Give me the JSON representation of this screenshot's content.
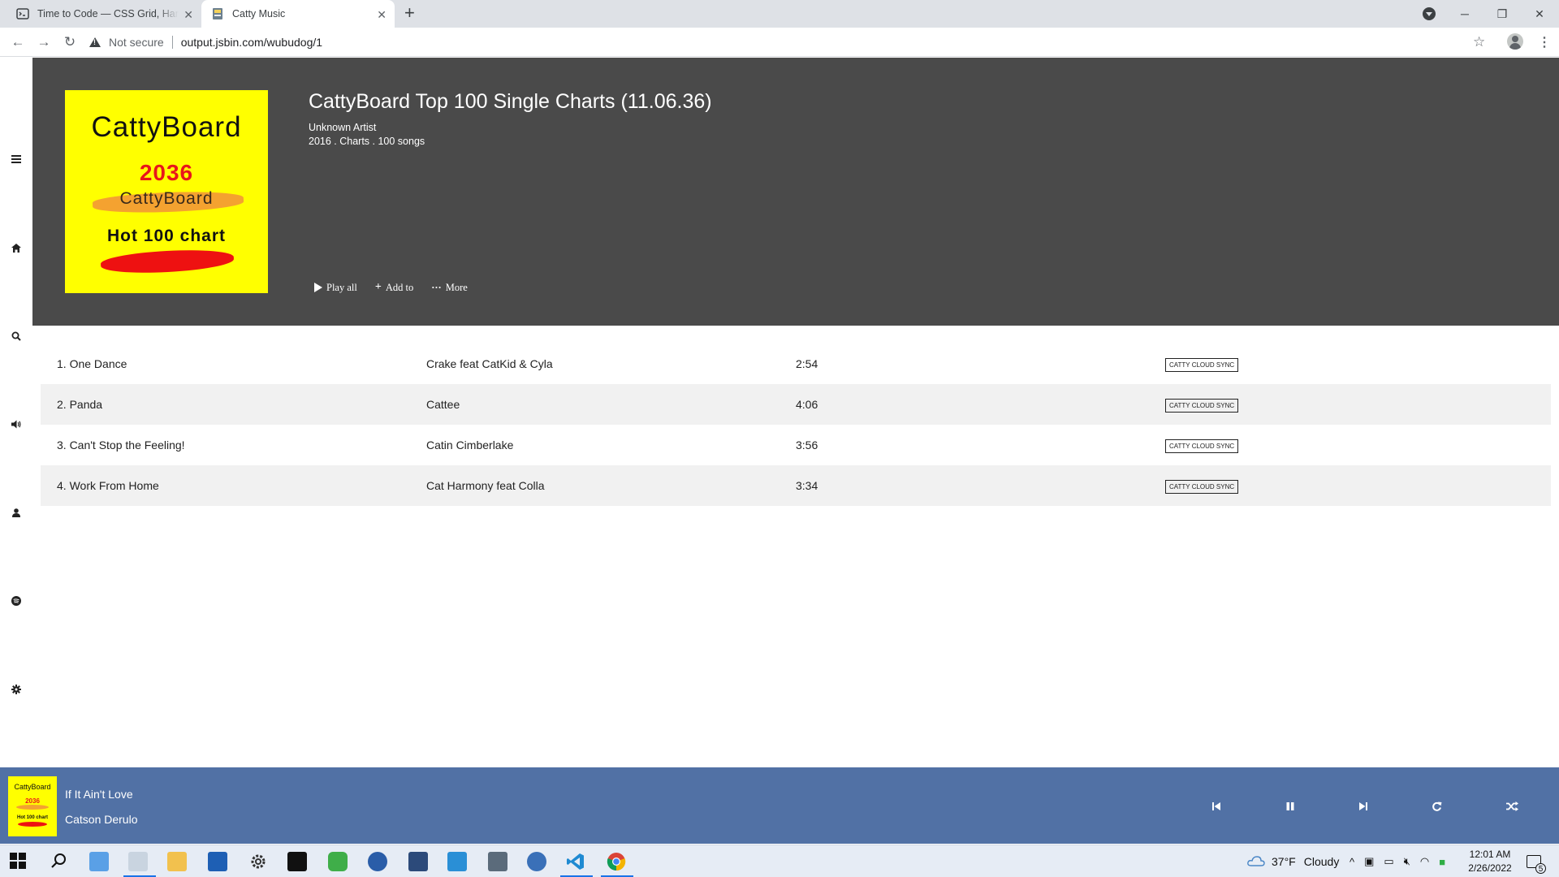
{
  "browser": {
    "tabs": [
      {
        "title": "Time to Code — CSS Grid, Hands",
        "active": false
      },
      {
        "title": "Catty Music",
        "active": true
      }
    ],
    "security_label": "Not secure",
    "url": "output.jsbin.com/wubudog/1"
  },
  "sidebar": {
    "icons": [
      "menu-icon",
      "home-icon",
      "search-icon",
      "volume-icon",
      "user-icon",
      "spotify-icon",
      "gear-icon",
      "soundcloud-icon"
    ]
  },
  "album": {
    "cover": {
      "brand": "CattyBoard",
      "year": "2036",
      "brand_secondary": "CattyBoard",
      "chart_name": "Hot 100 chart"
    },
    "title": "CattyBoard Top 100 Single Charts (11.06.36)",
    "artist": "Unknown Artist",
    "meta": "2016 . Charts . 100 songs",
    "actions": {
      "play_all": "Play all",
      "add_to": "Add to",
      "more": "More"
    }
  },
  "tracks": [
    {
      "title": "1. One Dance",
      "artist": "Crake feat CatKid & Cyla",
      "duration": "2:54",
      "badge": "CATTY CLOUD SYNC"
    },
    {
      "title": "2. Panda",
      "artist": "Cattee",
      "duration": "4:06",
      "badge": "CATTY CLOUD SYNC"
    },
    {
      "title": "3. Can't Stop the Feeling!",
      "artist": "Catin Cimberlake",
      "duration": "3:56",
      "badge": "CATTY CLOUD SYNC"
    },
    {
      "title": "4. Work From Home",
      "artist": "Cat Harmony feat Colla",
      "duration": "3:34",
      "badge": "CATTY CLOUD SYNC"
    }
  ],
  "player": {
    "song": "If It Ain't Love",
    "artist": "Catson Derulo",
    "mini_cover": {
      "brand": "CattyBoard",
      "year": "2036",
      "chart_name": "Hot 100 chart"
    },
    "controls": [
      "previous-icon",
      "pause-icon",
      "next-icon",
      "repeat-icon",
      "shuffle-icon"
    ],
    "bar_color": "#5171a5"
  },
  "taskbar": {
    "weather": {
      "temp": "37°F",
      "condition": "Cloudy"
    },
    "time": "12:01 AM",
    "date": "2/26/2022",
    "notifications": "5"
  },
  "colors": {
    "hero_bg": "#4a4a4a",
    "cover_bg": "#ffff00",
    "row_alt": "#f1f1f1"
  }
}
